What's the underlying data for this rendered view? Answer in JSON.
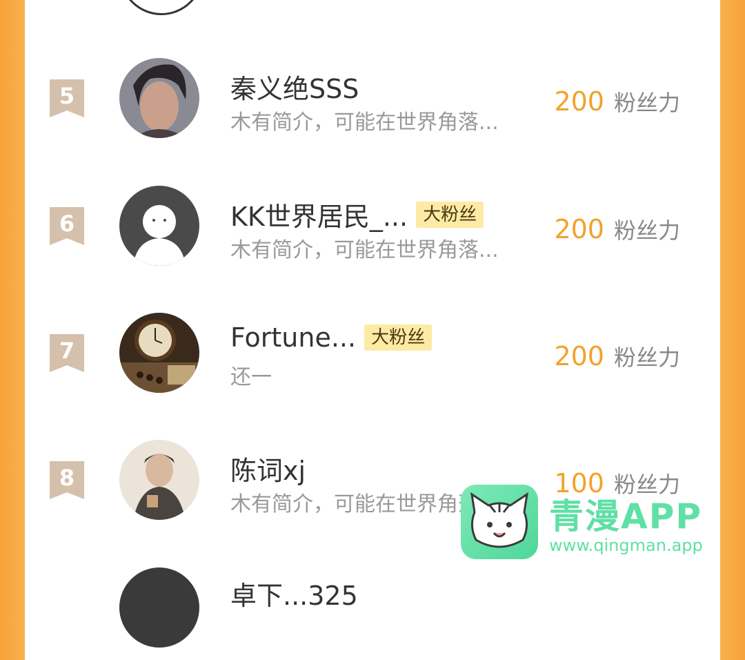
{
  "score_unit": "粉丝力",
  "rows": [
    {
      "rank": "5",
      "name": "秦义绝SSS",
      "tag": "",
      "bio": "木有简介，可能在世界角落...",
      "score": "200"
    },
    {
      "rank": "6",
      "name": "KK世界居民_...",
      "tag": "大粉丝",
      "bio": "木有简介，可能在世界角落...",
      "score": "200"
    },
    {
      "rank": "7",
      "name": "Fortune...",
      "tag": "大粉丝",
      "bio": "还一",
      "score": "200"
    },
    {
      "rank": "8",
      "name": "陈词xj",
      "tag": "",
      "bio": "木有简介，可能在世界角落...",
      "score": "100"
    }
  ],
  "partial_next": {
    "name": "卓下...325"
  },
  "watermark": {
    "title": "青漫APP",
    "url": "www.qingman.app"
  }
}
